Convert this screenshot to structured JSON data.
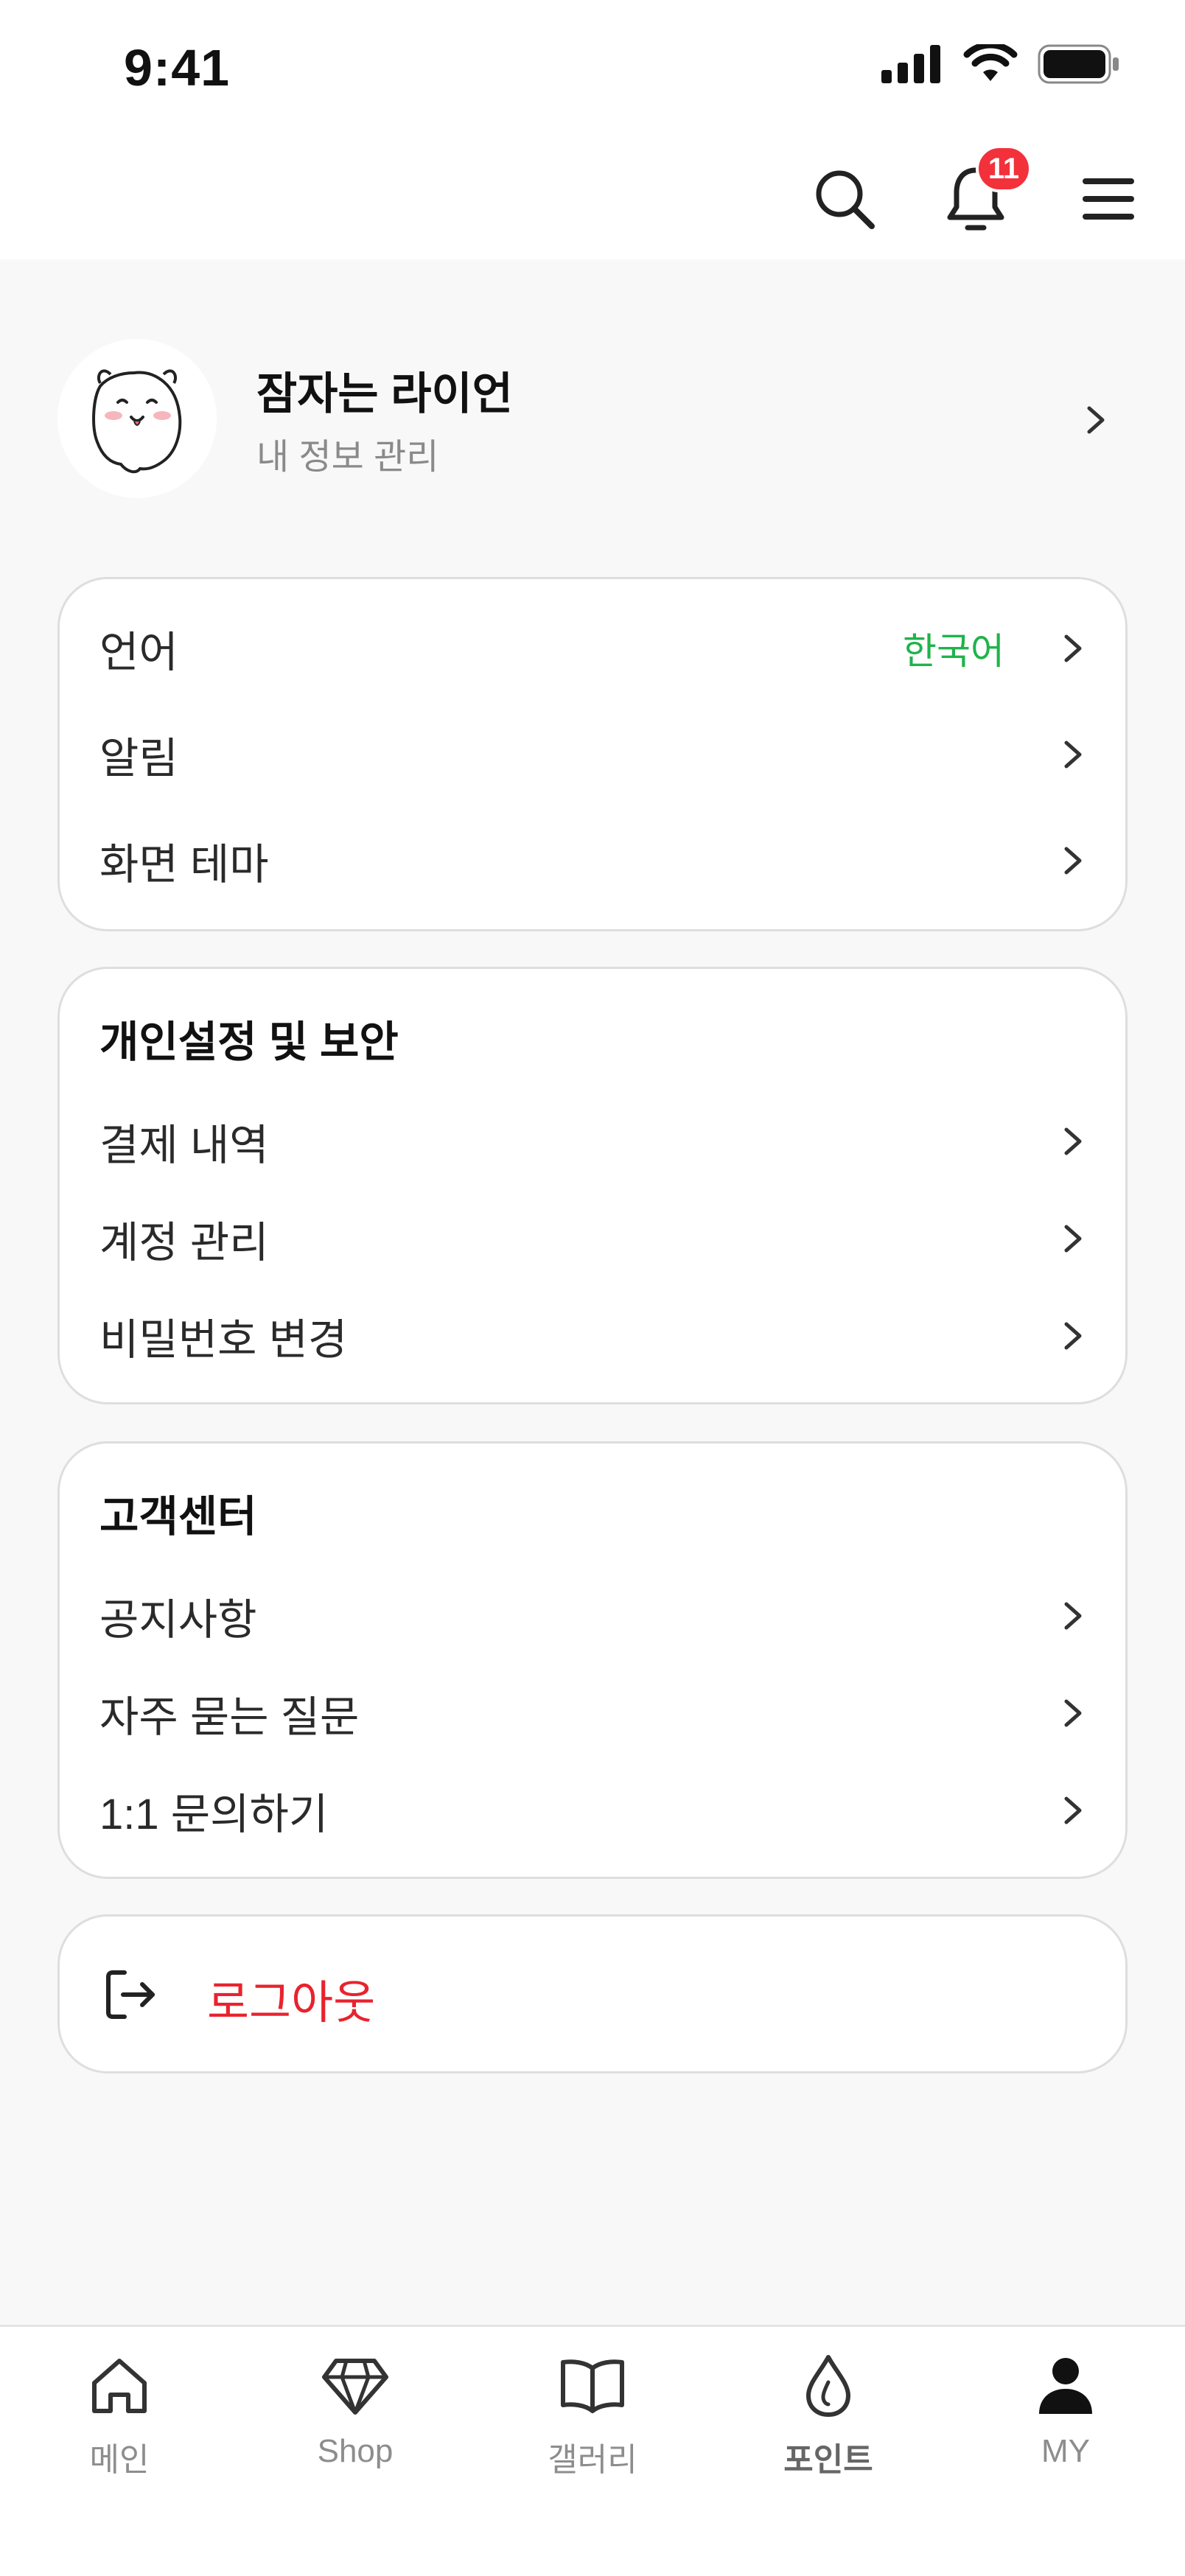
{
  "status_bar": {
    "time": "9:41"
  },
  "header": {
    "notification_count": "11"
  },
  "profile": {
    "name": "잠자는 라이언",
    "subtitle": "내 정보 관리"
  },
  "settings_card": {
    "items": [
      {
        "label": "언어",
        "value": "한국어"
      },
      {
        "label": "알림"
      },
      {
        "label": "화면 테마"
      }
    ]
  },
  "privacy_card": {
    "title": "개인설정 및 보안",
    "items": [
      {
        "label": "결제 내역"
      },
      {
        "label": "계정 관리"
      },
      {
        "label": "비밀번호 변경"
      }
    ]
  },
  "support_card": {
    "title": "고객센터",
    "items": [
      {
        "label": "공지사항"
      },
      {
        "label": "자주 묻는 질문"
      },
      {
        "label": "1:1 문의하기"
      }
    ]
  },
  "logout": {
    "label": "로그아웃"
  },
  "bottom_nav": {
    "items": [
      {
        "label": "메인",
        "icon": "home-icon"
      },
      {
        "label": "Shop",
        "icon": "diamond-icon"
      },
      {
        "label": "갤러리",
        "icon": "book-icon"
      },
      {
        "label": "포인트",
        "icon": "drop-icon"
      },
      {
        "label": "MY",
        "icon": "person-icon"
      }
    ]
  },
  "colors": {
    "accent_green": "#1fb34b",
    "logout_red": "#e8232e",
    "badge_red": "#f2313b"
  }
}
